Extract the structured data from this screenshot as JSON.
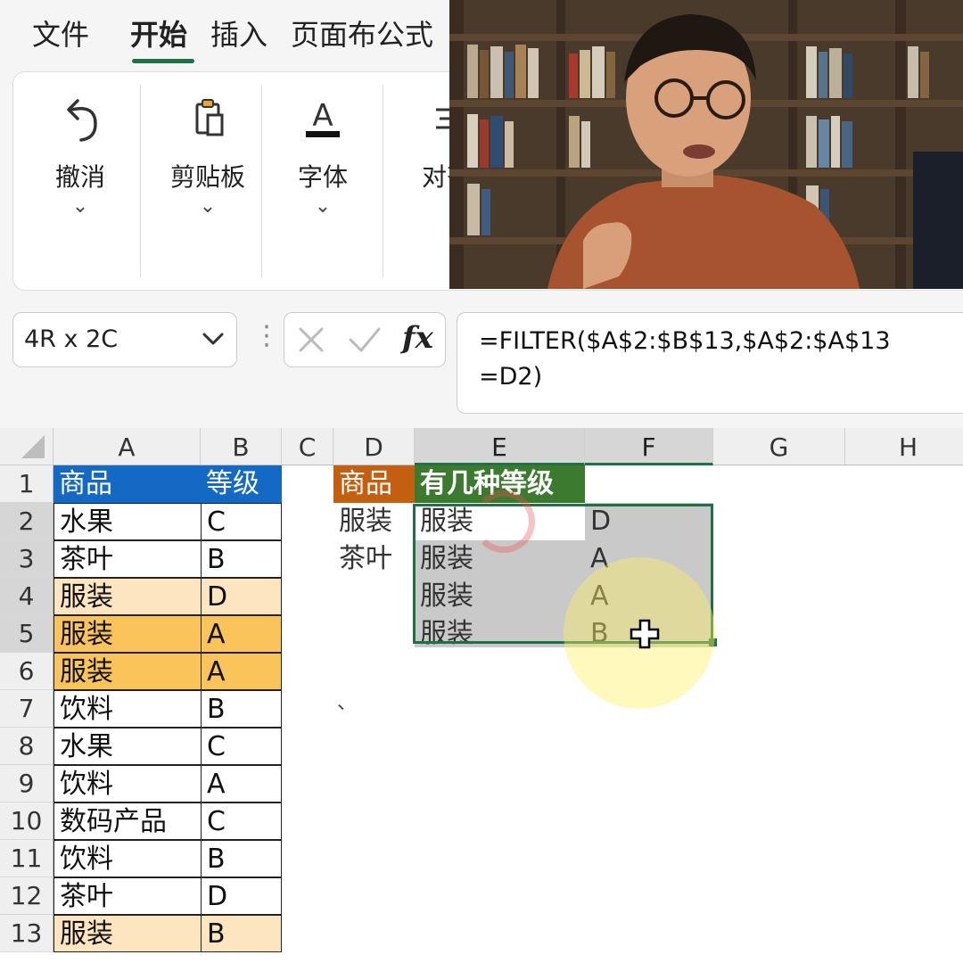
{
  "ribbon": {
    "tabs": [
      "文件",
      "开始",
      "插入",
      "页面布",
      "公式"
    ],
    "active_tab": "开始",
    "groups": [
      {
        "label": "撤消",
        "icon": "undo-icon"
      },
      {
        "label": "剪贴板",
        "icon": "clipboard-icon"
      },
      {
        "label": "字体",
        "icon": "font-color-icon"
      },
      {
        "label": "对齐",
        "icon": "align-icon"
      }
    ]
  },
  "formula_bar": {
    "name_box": "4R x 2C",
    "fx": "fx",
    "formula": "=FILTER($A$2:$B$13,$A$2:$A$13\n=D2)"
  },
  "sheet": {
    "columns": [
      "A",
      "B",
      "C",
      "D",
      "E",
      "F",
      "G",
      "H"
    ],
    "rows": [
      "1",
      "2",
      "3",
      "4",
      "5",
      "6",
      "7",
      "8",
      "9",
      "10",
      "11",
      "12",
      "13"
    ],
    "col_a_b": [
      [
        "商品",
        "等级"
      ],
      [
        "水果",
        "C"
      ],
      [
        "茶叶",
        "B"
      ],
      [
        "服装",
        "D"
      ],
      [
        "服装",
        "A"
      ],
      [
        "服装",
        "A"
      ],
      [
        "饮料",
        "B"
      ],
      [
        "水果",
        "C"
      ],
      [
        "饮料",
        "A"
      ],
      [
        "数码产品",
        "C"
      ],
      [
        "饮料",
        "B"
      ],
      [
        "茶叶",
        "D"
      ],
      [
        "服装",
        "B"
      ]
    ],
    "col_d": [
      "商品",
      "服装",
      "茶叶"
    ],
    "e1_header": "有几种等级",
    "spill": [
      [
        "服装",
        "D"
      ],
      [
        "服装",
        "A"
      ],
      [
        "服装",
        "A"
      ],
      [
        "服装",
        "B"
      ]
    ],
    "stray_mark": "、",
    "colors": {
      "accent_green": "#1e7145",
      "header_blue": "#1469c4",
      "header_orange": "#c45f12",
      "header_green": "#3c7a2f",
      "highlight_light": "#fde6bf",
      "highlight_strong": "#fbc45a"
    }
  },
  "overlay": {
    "webcam": "presenter-webcam-feed"
  }
}
